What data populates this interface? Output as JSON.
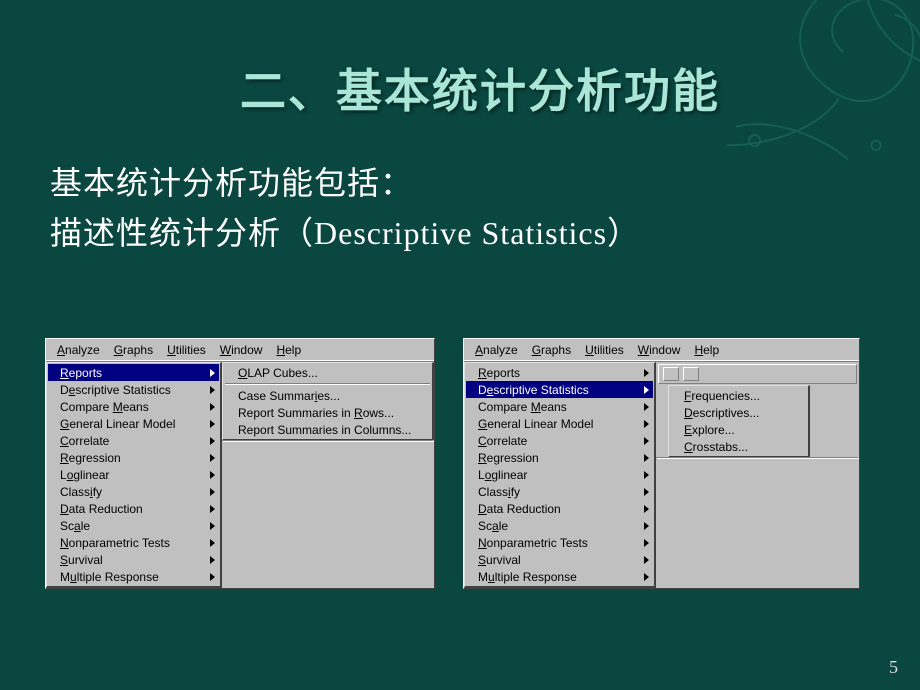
{
  "slide": {
    "title": "二、基本统计分析功能",
    "subtitle_line1": "基本统计分析功能包括：",
    "subtitle_line2": "描述性统计分析（Descriptive Statistics）",
    "page_number": "5"
  },
  "menubar": {
    "items": [
      {
        "label": "Analyze",
        "ul_index": 0
      },
      {
        "label": "Graphs",
        "ul_index": 0
      },
      {
        "label": "Utilities",
        "ul_index": 0
      },
      {
        "label": "Window",
        "ul_index": 0
      },
      {
        "label": "Help",
        "ul_index": 0
      }
    ]
  },
  "analyze_menu": {
    "items": [
      {
        "label": "Reports",
        "ul_index": 0,
        "has_sub": true
      },
      {
        "label": "Descriptive Statistics",
        "ul_index": 1,
        "has_sub": true
      },
      {
        "label": "Compare Means",
        "ul_index": 8,
        "has_sub": true
      },
      {
        "label": "General Linear Model",
        "ul_index": 0,
        "has_sub": true
      },
      {
        "label": "Correlate",
        "ul_index": 0,
        "has_sub": true
      },
      {
        "label": "Regression",
        "ul_index": 0,
        "has_sub": true
      },
      {
        "label": "Loglinear",
        "ul_index": 1,
        "has_sub": true
      },
      {
        "label": "Classify",
        "ul_index": 5,
        "has_sub": true
      },
      {
        "label": "Data Reduction",
        "ul_index": 0,
        "has_sub": true
      },
      {
        "label": "Scale",
        "ul_index": 2,
        "has_sub": true
      },
      {
        "label": "Nonparametric Tests",
        "ul_index": 0,
        "has_sub": true
      },
      {
        "label": "Survival",
        "ul_index": 0,
        "has_sub": true
      },
      {
        "label": "Multiple Response",
        "ul_index": 1,
        "has_sub": true
      }
    ]
  },
  "left_screenshot": {
    "selected_index": 0,
    "submenu": {
      "items": [
        {
          "label": "OLAP Cubes...",
          "ul_index": 0
        },
        {
          "sep": true
        },
        {
          "label": "Case Summaries...",
          "ul_index": 11
        },
        {
          "label": "Report Summaries in Rows...",
          "ul_index": 20
        },
        {
          "label": "Report Summaries in Columns...",
          "ul_index": -1
        }
      ]
    }
  },
  "right_screenshot": {
    "selected_index": 1,
    "submenu": {
      "items": [
        {
          "label": "Frequencies...",
          "ul_index": 0
        },
        {
          "label": "Descriptives...",
          "ul_index": 0
        },
        {
          "label": "Explore...",
          "ul_index": 0
        },
        {
          "label": "Crosstabs...",
          "ul_index": 0
        }
      ]
    }
  }
}
